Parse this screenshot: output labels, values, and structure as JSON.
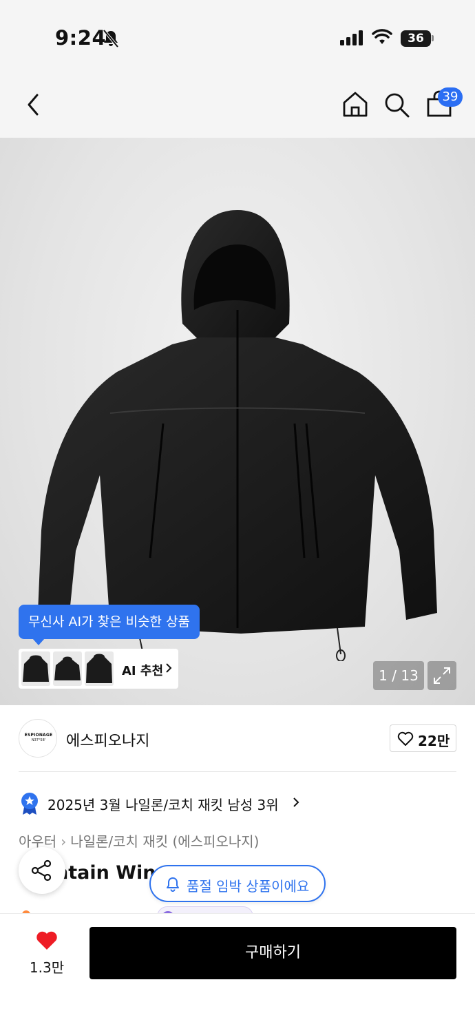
{
  "status_bar": {
    "time": "9:24",
    "battery": "36",
    "icons": [
      "bell-slash-icon",
      "cellular-signal-icon",
      "wifi-icon",
      "battery-icon"
    ]
  },
  "nav": {
    "icons": [
      "back-chevron-icon",
      "home-icon",
      "search-icon",
      "shopping-bag-icon"
    ],
    "cart_badge": "39",
    "accent_color": "#2b6ef3"
  },
  "gallery": {
    "ai_tooltip": "무신사 AI가 찾은 비슷한 상품",
    "ai_button_label": "AI 추천",
    "counter": "1 / 13"
  },
  "brand": {
    "logo_text": "ESPIONAGE",
    "logo_subtext": "N37°58'",
    "name": "에스피오나지",
    "like_count": "22만"
  },
  "ranking": {
    "text": "2025년 3월 나일론/코치 재킷 남성 3위"
  },
  "breadcrumb": {
    "category": "아우터",
    "subcategory": "나일론/코치 재킷 (에스피오나지)"
  },
  "product": {
    "title_visible": "ntain Win"
  },
  "floating": {
    "soldout_text": "품절 임박 상품이에요",
    "soldout_color": "#2f73ee"
  },
  "bottom_bar": {
    "heart_count": "1.3만",
    "buy_label": "구매하기"
  }
}
